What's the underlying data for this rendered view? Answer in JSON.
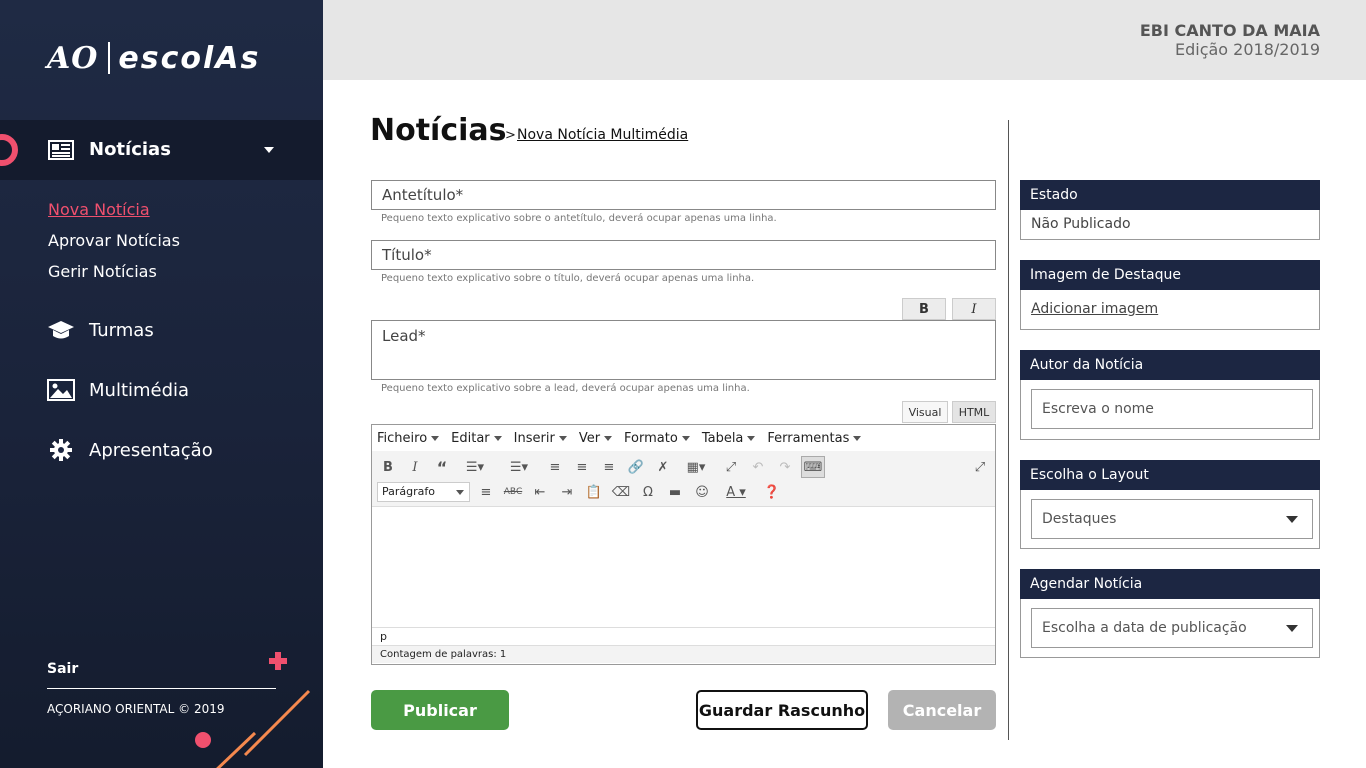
{
  "brand": {
    "logo_ao": "AO",
    "logo_escolas": "escolAs"
  },
  "sidebar": {
    "active_section": "Notícias",
    "subnav": [
      "Nova Notícia",
      "Aprovar Notícias",
      "Gerir Notícias"
    ],
    "items": [
      {
        "label": "Turmas",
        "icon": "graduation-cap-icon"
      },
      {
        "label": "Multimédia",
        "icon": "image-icon"
      },
      {
        "label": "Apresentação",
        "icon": "gear-icon"
      }
    ],
    "logout": "Sair",
    "copyright": "AÇORIANO ORIENTAL © 2019"
  },
  "header": {
    "school": "EBI CANTO DA MAIA",
    "edition": "Edição 2018/2019"
  },
  "main": {
    "title": "Notícias",
    "breadcrumb_sep": ">",
    "breadcrumb": "Nova Notícia Multimédia",
    "antetitulo_placeholder": "Antetítulo*",
    "antetitulo_help": "Pequeno texto explicativo sobre o antetítulo, deverá ocupar apenas uma linha.",
    "titulo_placeholder": "Título*",
    "titulo_help": "Pequeno texto explicativo sobre o título, deverá ocupar apenas uma linha.",
    "lead_bold": "B",
    "lead_italic": "I",
    "lead_placeholder": "Lead*",
    "lead_help": "Pequeno texto explicativo sobre a lead, deverá ocupar apenas uma linha.",
    "tab_visual": "Visual",
    "tab_html": "HTML"
  },
  "editor": {
    "menus": [
      "Ficheiro",
      "Editar",
      "Inserir",
      "Ver",
      "Formato",
      "Tabela",
      "Ferramentas"
    ],
    "format_select": "Parágrafo",
    "statuspath": "p",
    "wordcount": "Contagem de palavras: 1"
  },
  "actions": {
    "publish": "Publicar",
    "draft": "Guardar Rascunho",
    "cancel": "Cancelar"
  },
  "panel": {
    "estado_title": "Estado",
    "estado_value": "Não Publicado",
    "image_title": "Imagem de Destaque",
    "image_link": "Adicionar imagem",
    "author_title": "Autor da Notícia",
    "author_placeholder": "Escreva o nome",
    "layout_title": "Escolha o Layout",
    "layout_value": "Destaques",
    "schedule_title": "Agendar Notícia",
    "schedule_value": "Escolha a data de publicação"
  },
  "colors": {
    "accent": "#f0506e",
    "navy": "#1c2642",
    "publish": "#4a9a44",
    "cancel": "#b3b3b3"
  }
}
